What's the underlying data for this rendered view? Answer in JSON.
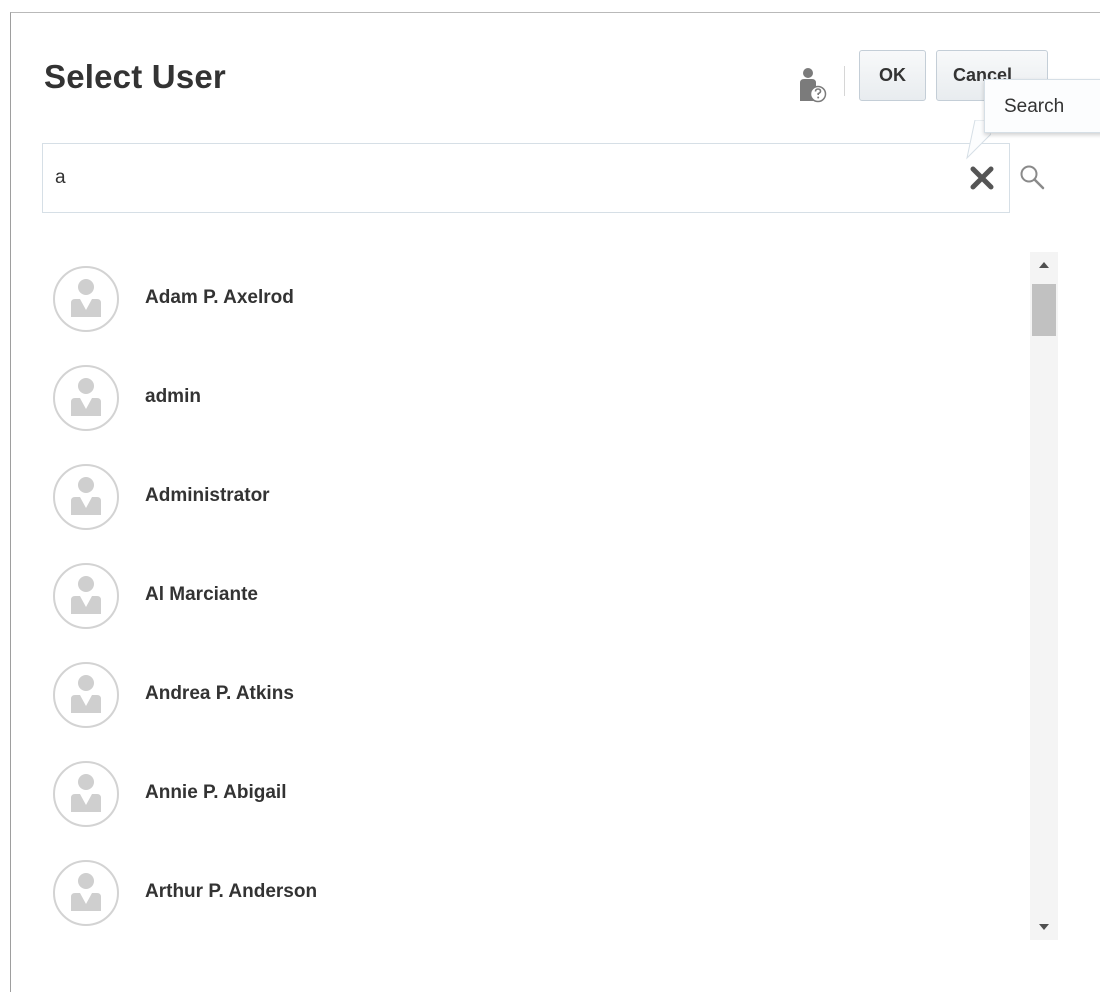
{
  "dialog": {
    "title": "Select User",
    "ok_label": "OK",
    "cancel_label": "Cancel"
  },
  "search": {
    "value": "a",
    "tooltip": "Search"
  },
  "users": [
    {
      "name": "Adam P. Axelrod"
    },
    {
      "name": "admin"
    },
    {
      "name": "Administrator"
    },
    {
      "name": "Al Marciante"
    },
    {
      "name": "Andrea P. Atkins"
    },
    {
      "name": "Annie P. Abigail"
    },
    {
      "name": "Arthur P. Anderson"
    }
  ],
  "icons": {
    "user_help": "user-help-icon",
    "clear": "close-icon",
    "search": "search-icon",
    "avatar": "user-avatar-icon"
  },
  "colors": {
    "title_text": "#333333",
    "button_border": "#c4ced7",
    "field_border": "#d6dfe6",
    "scroll_thumb": "#c1c1c1"
  }
}
